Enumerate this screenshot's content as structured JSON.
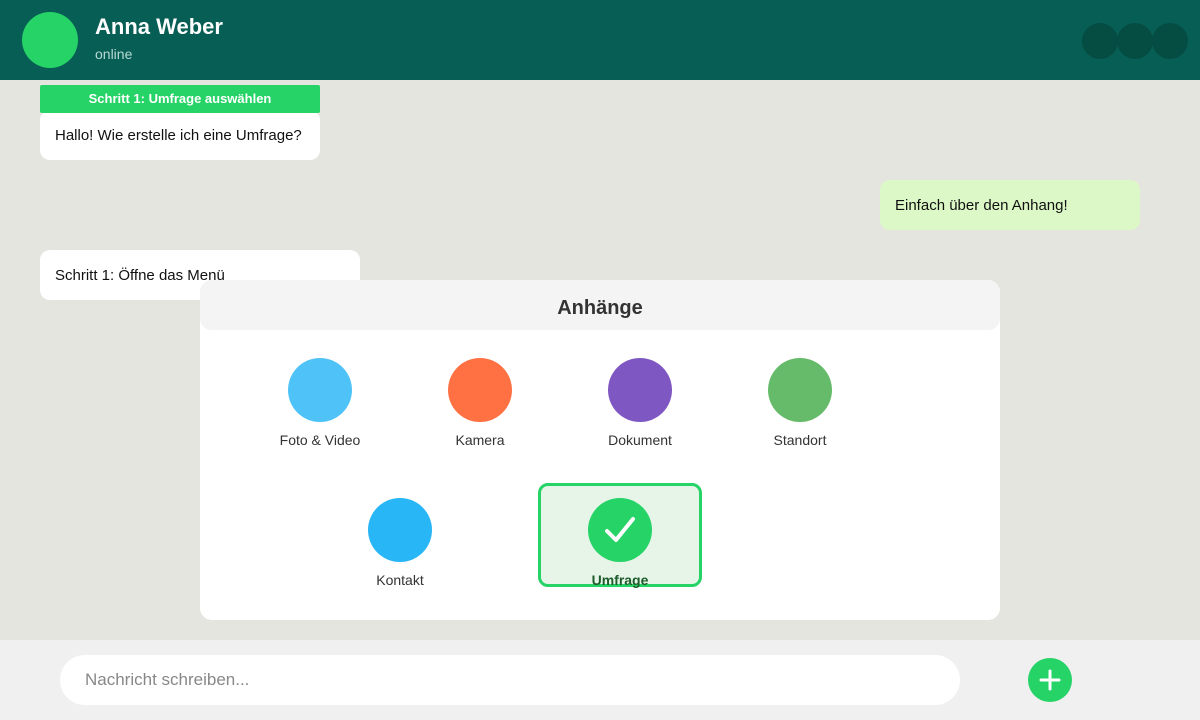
{
  "header": {
    "name": "Anna Weber",
    "status": "online",
    "actions": [
      {
        "icon": "video-call-icon"
      },
      {
        "icon": "phone-icon"
      },
      {
        "icon": "menu-icon"
      }
    ]
  },
  "step_tag": "Schritt 1: Umfrage auswählen",
  "messages": [
    {
      "direction": "in",
      "text": "Hallo! Wie erstelle ich eine Umfrage?"
    },
    {
      "direction": "out",
      "text": "Einfach über den Anhang!"
    },
    {
      "direction": "in",
      "text": "Schritt 1: Öffne das Menü"
    }
  ],
  "attachment_sheet": {
    "title": "Anhänge",
    "options": [
      {
        "label": "Foto & Video",
        "icon": "photo-video-icon",
        "color": "#4fc3f7"
      },
      {
        "label": "Kamera",
        "icon": "camera-icon",
        "color": "#ff7043"
      },
      {
        "label": "Dokument",
        "icon": "document-icon",
        "color": "#7e57c2"
      },
      {
        "label": "Standort",
        "icon": "location-icon",
        "color": "#66bb6a"
      },
      {
        "label": "Kontakt",
        "icon": "contact-icon",
        "color": "#29b6f6"
      },
      {
        "label": "Umfrage",
        "icon": "checkmark-icon",
        "color": "#25d366",
        "selected": true
      }
    ]
  },
  "composer": {
    "placeholder": "Nachricht schreiben...",
    "add_icon": "plus-icon"
  },
  "colors": {
    "header": "#075e54",
    "accent": "#25d366",
    "chat_background": "#e5e5df",
    "outgoing_bubble": "#dcf8c6",
    "incoming_bubble": "#ffffff"
  }
}
